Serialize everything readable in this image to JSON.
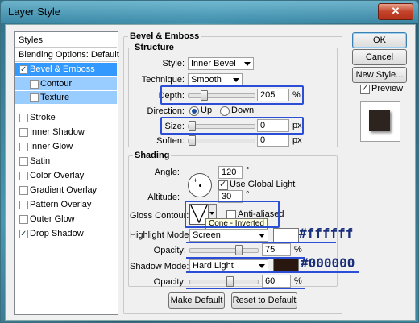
{
  "window": {
    "title": "Layer Style",
    "close_symbol": "✕"
  },
  "styles_list": {
    "items": [
      {
        "label": "Styles"
      },
      {
        "label": "Blending Options: Default"
      },
      {
        "label": "Bevel & Emboss",
        "checked": true
      },
      {
        "label": "Contour",
        "checked": false
      },
      {
        "label": "Texture",
        "checked": false
      },
      {
        "label": "Stroke",
        "checked": false
      },
      {
        "label": "Inner Shadow",
        "checked": false
      },
      {
        "label": "Inner Glow",
        "checked": false
      },
      {
        "label": "Satin",
        "checked": false
      },
      {
        "label": "Color Overlay",
        "checked": false
      },
      {
        "label": "Gradient Overlay",
        "checked": false
      },
      {
        "label": "Pattern Overlay",
        "checked": false
      },
      {
        "label": "Outer Glow",
        "checked": false
      },
      {
        "label": "Drop Shadow",
        "checked": true
      }
    ]
  },
  "bevel": {
    "heading": "Bevel & Emboss",
    "structure": {
      "heading": "Structure",
      "style_label": "Style:",
      "style_value": "Inner Bevel",
      "technique_label": "Technique:",
      "technique_value": "Smooth",
      "depth_label": "Depth:",
      "depth_value": "205",
      "depth_unit": "%",
      "depth_level": 0.2,
      "direction_label": "Direction:",
      "direction_up": "Up",
      "direction_down": "Down",
      "direction_selected": "Up",
      "size_label": "Size:",
      "size_value": "0",
      "size_unit": "px",
      "size_level": 0.0,
      "soften_label": "Soften:",
      "soften_value": "0",
      "soften_unit": "px",
      "soften_level": 0.0
    },
    "shading": {
      "heading": "Shading",
      "angle_label": "Angle:",
      "angle_value": "120",
      "angle_unit": "°",
      "global_light_label": "Use Global Light",
      "global_light_checked": true,
      "altitude_label": "Altitude:",
      "altitude_value": "30",
      "altitude_unit": "°",
      "gloss_label": "Gloss Contour:",
      "anti_aliased_label": "Anti-aliased",
      "anti_aliased_checked": false,
      "tooltip": "Cone - Inverted",
      "highlight_label": "Highlight Mode:",
      "highlight_value": "Screen",
      "highlight_color": "#ffffff",
      "highlight_hex_annotation": "#ffffff",
      "opacity1_label": "Opacity:",
      "opacity1_value": "75",
      "opacity1_unit": "%",
      "opacity1_level": 0.75,
      "shadow_label": "Shadow Mode:",
      "shadow_value": "Hard Light",
      "shadow_color": "#2a1810",
      "shadow_hex_annotation": "#000000",
      "opacity2_label": "Opacity:",
      "opacity2_value": "60",
      "opacity2_unit": "%",
      "opacity2_level": 0.6
    },
    "make_default": "Make Default",
    "reset_default": "Reset to Default"
  },
  "buttons": {
    "ok": "OK",
    "cancel": "Cancel",
    "new_style": "New Style...",
    "preview_label": "Preview",
    "preview_checked": true
  },
  "colors": {
    "annotation": "#2a4fd6",
    "selected": "#3399ff",
    "subselected": "#99ccff"
  }
}
